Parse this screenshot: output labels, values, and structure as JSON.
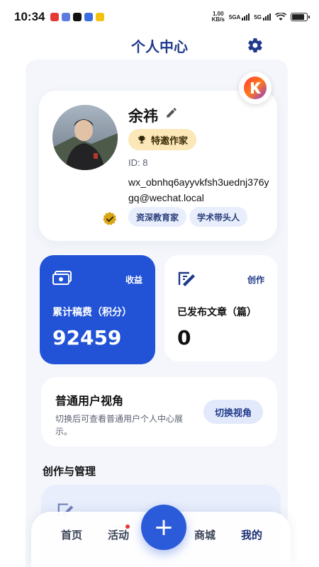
{
  "status_bar": {
    "time": "10:34",
    "net_speed_value": "1.00",
    "net_speed_unit": "KB/s",
    "sim1": "5GA",
    "sim2": "5G",
    "battery_level": 0.85
  },
  "header": {
    "title": "个人中心",
    "settings_icon": "gear-icon"
  },
  "profile": {
    "name": "余祎",
    "role_badge": "特邀作家",
    "id_text": "ID: 8",
    "email": "wx_obnhq6ayyvkfsh3uednj376ygq@wechat.local",
    "tags": [
      "资深教育家",
      "学术带头人"
    ]
  },
  "stats": {
    "earnings": {
      "tag": "收益",
      "label": "累计稿费（积分）",
      "value": "92459"
    },
    "articles": {
      "tag": "创作",
      "label": "已发布文章（篇）",
      "value": "0"
    }
  },
  "perspective": {
    "title": "普通用户视角",
    "description": "切换后可查看普通用户个人中心展示。",
    "button": "切换视角"
  },
  "section": {
    "title": "创作与管理"
  },
  "nav": {
    "home": "首页",
    "activity": "活动",
    "mall": "商城",
    "mine": "我的",
    "fab_symbol": "+"
  },
  "colors": {
    "primary": "#2253d6",
    "title": "#1f3a8a",
    "badge_bg": "#fbe7b8",
    "tag_bg": "#e8eefc",
    "panel_bg": "#f4f6fb"
  }
}
